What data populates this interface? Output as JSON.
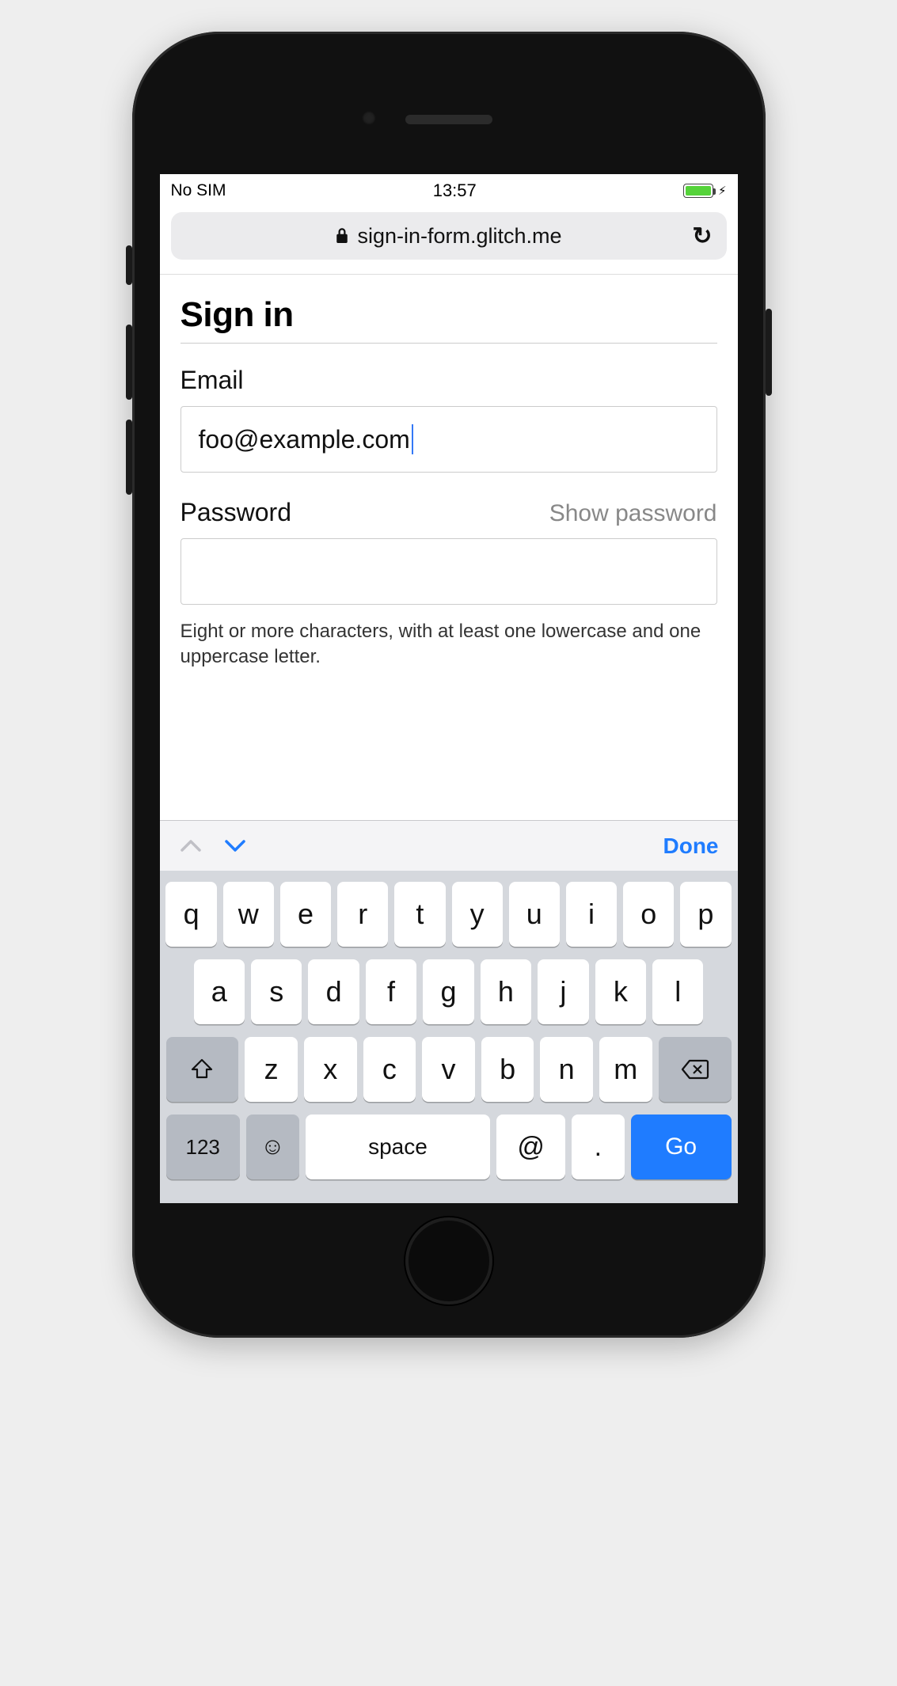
{
  "status_bar": {
    "carrier": "No SIM",
    "time": "13:57"
  },
  "url_bar": {
    "domain": "sign-in-form.glitch.me"
  },
  "page": {
    "title": "Sign in",
    "email_label": "Email",
    "email_value": "foo@example.com",
    "password_label": "Password",
    "show_password": "Show password",
    "password_value": "",
    "help_text": "Eight or more characters, with at least one lowercase and one uppercase letter."
  },
  "kb_accessory": {
    "done": "Done"
  },
  "keyboard": {
    "row1": [
      "q",
      "w",
      "e",
      "r",
      "t",
      "y",
      "u",
      "i",
      "o",
      "p"
    ],
    "row2": [
      "a",
      "s",
      "d",
      "f",
      "g",
      "h",
      "j",
      "k",
      "l"
    ],
    "row3": [
      "z",
      "x",
      "c",
      "v",
      "b",
      "n",
      "m"
    ],
    "num_label": "123",
    "space_label": "space",
    "at_label": "@",
    "dot_label": ".",
    "go_label": "Go"
  }
}
